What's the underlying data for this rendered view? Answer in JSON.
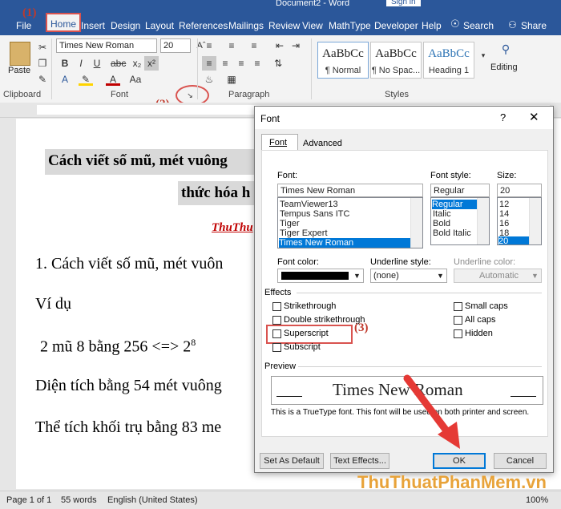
{
  "titlebar": {
    "doc_title": "Document2 - Word",
    "signin": "Sign in"
  },
  "tabs": [
    "File",
    "Home",
    "Insert",
    "Design",
    "Layout",
    "References",
    "Mailings",
    "Review",
    "View",
    "MathType",
    "Developer",
    "Help"
  ],
  "tell_me": "Search",
  "share": "Share",
  "ribbon": {
    "paste": "Paste",
    "clipboard": "Clipboard",
    "font_name": "Times New Roman",
    "font_size": "20",
    "font_group": "Font",
    "paragraph_group": "Paragraph",
    "styles_group": "Styles",
    "styles": [
      {
        "sample": "AaBbCc",
        "name": "¶ Normal"
      },
      {
        "sample": "AaBbCc",
        "name": "¶ No Spac..."
      },
      {
        "sample": "AaBbCc",
        "name": "Heading 1"
      }
    ],
    "editing": "Editing"
  },
  "annotations": {
    "a1": "(1)",
    "a2": "(2)",
    "a3": "(3)"
  },
  "document": {
    "heading_line1": "Cách viết số mũ, mét vuông",
    "heading_line2": "thức hóa h",
    "author": "ThuThu",
    "item1": "1. Cách viết số mũ, mét vuôn",
    "example": "Ví dụ",
    "line_power": "2 mũ 8 bằng 256 <=> 2",
    "line_power_sup": "8",
    "line_area": "Diện tích bằng 54 mét vuông",
    "line_volume": "Thể tích khối trụ bằng 83 me"
  },
  "dialog": {
    "title": "Font",
    "help": "?",
    "tab_font": "Font",
    "tab_advanced": "Advanced",
    "font_label": "Font:",
    "font_value": "Times New Roman",
    "font_list": [
      "TeamViewer13",
      "Tempus Sans ITC",
      "Tiger",
      "Tiger Expert",
      "Times New Roman"
    ],
    "style_label": "Font style:",
    "style_value": "Regular",
    "style_list": [
      "Regular",
      "Italic",
      "Bold",
      "Bold Italic"
    ],
    "size_label": "Size:",
    "size_value": "20",
    "size_list": [
      "12",
      "14",
      "16",
      "18",
      "20"
    ],
    "font_color_label": "Font color:",
    "underline_style_label": "Underline style:",
    "underline_style_value": "(none)",
    "underline_color_label": "Underline color:",
    "underline_color_value": "Automatic",
    "effects_label": "Effects",
    "effects_left": [
      "Strikethrough",
      "Double strikethrough",
      "Superscript",
      "Subscript"
    ],
    "effects_right": [
      "Small caps",
      "All caps",
      "Hidden"
    ],
    "preview_label": "Preview",
    "preview_text": "Times New Roman",
    "preview_note": "This is a TrueType font. This font will be used on both printer and screen.",
    "set_default": "Set As Default",
    "text_effects": "Text Effects...",
    "ok": "OK",
    "cancel": "Cancel"
  },
  "statusbar": {
    "page": "Page 1 of 1",
    "words": "55 words",
    "language": "English (United States)",
    "zoom": "100%"
  },
  "watermark": "ThuThuatPhanMem.vn",
  "colors": {
    "brand": "#2b579a",
    "selection": "#0078d7",
    "annotation": "#d9534f"
  }
}
